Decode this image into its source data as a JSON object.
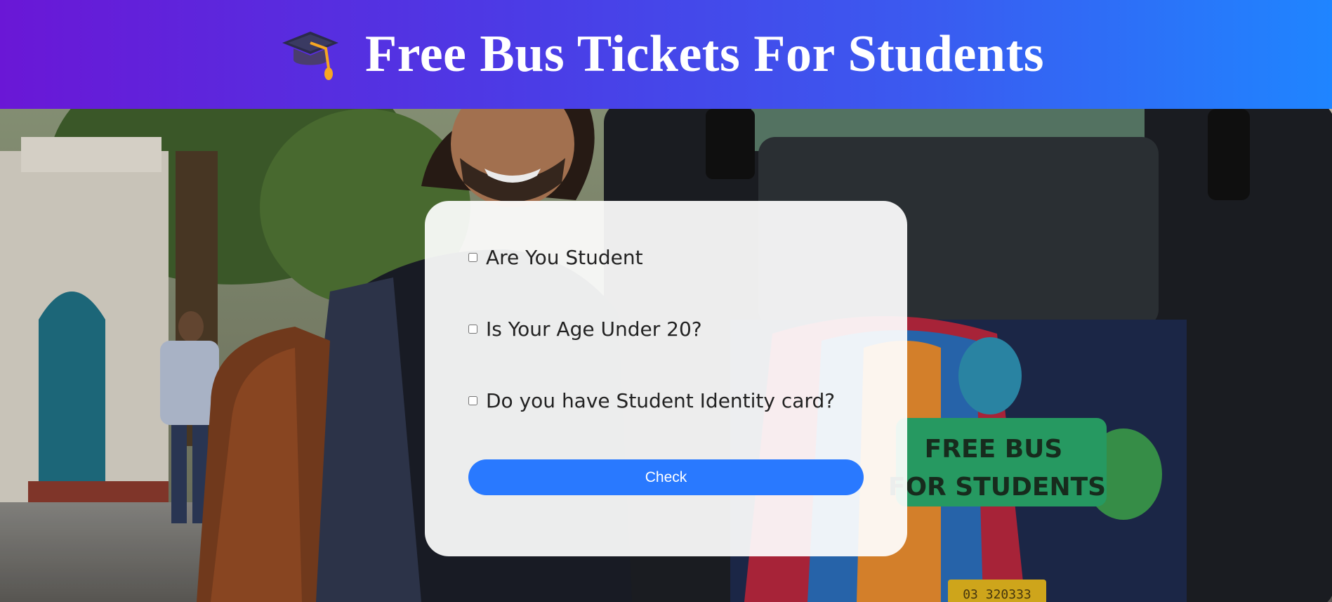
{
  "header": {
    "icon": "graduation-cap-icon",
    "title": "Free Bus Tickets For Students"
  },
  "form": {
    "options": [
      {
        "label": "Are You Student",
        "checked": false
      },
      {
        "label": "Is Your Age Under 20?",
        "checked": false
      },
      {
        "label": "Do you have Student Identity card?",
        "checked": false
      }
    ],
    "button_label": "Check"
  },
  "background": {
    "sign_line1": "FREE BUS",
    "sign_line2": "FOR STUDENTS",
    "plate": "03 320333"
  },
  "colors": {
    "header_start": "#6a17d6",
    "header_end": "#1f85ff",
    "button": "#2979ff",
    "sign": "#2aa66a"
  }
}
